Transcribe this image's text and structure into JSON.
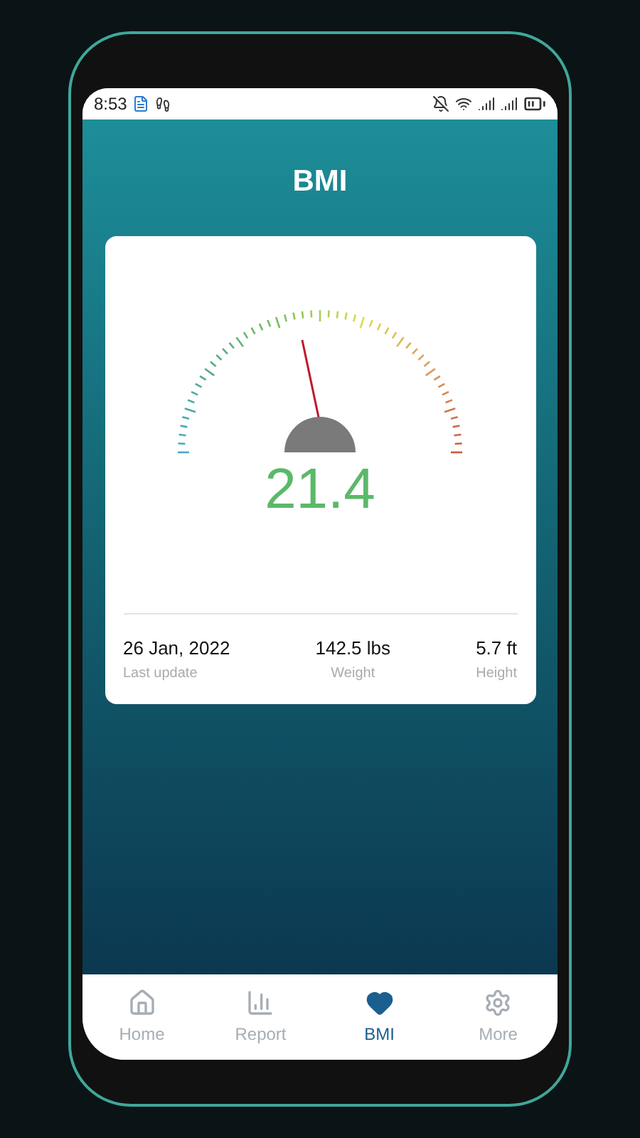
{
  "status_bar": {
    "time": "8:53"
  },
  "title": "BMI",
  "gauge": {
    "reading": "21.4"
  },
  "stats": [
    {
      "value": "26 Jan, 2022",
      "label": "Last update"
    },
    {
      "value": "142.5 lbs",
      "label": "Weight"
    },
    {
      "value": "5.7 ft",
      "label": "Height"
    }
  ],
  "nav": [
    {
      "label": "Home",
      "selected": false
    },
    {
      "label": "Report",
      "selected": false
    },
    {
      "label": "BMI",
      "selected": true
    },
    {
      "label": "More",
      "selected": false
    }
  ]
}
